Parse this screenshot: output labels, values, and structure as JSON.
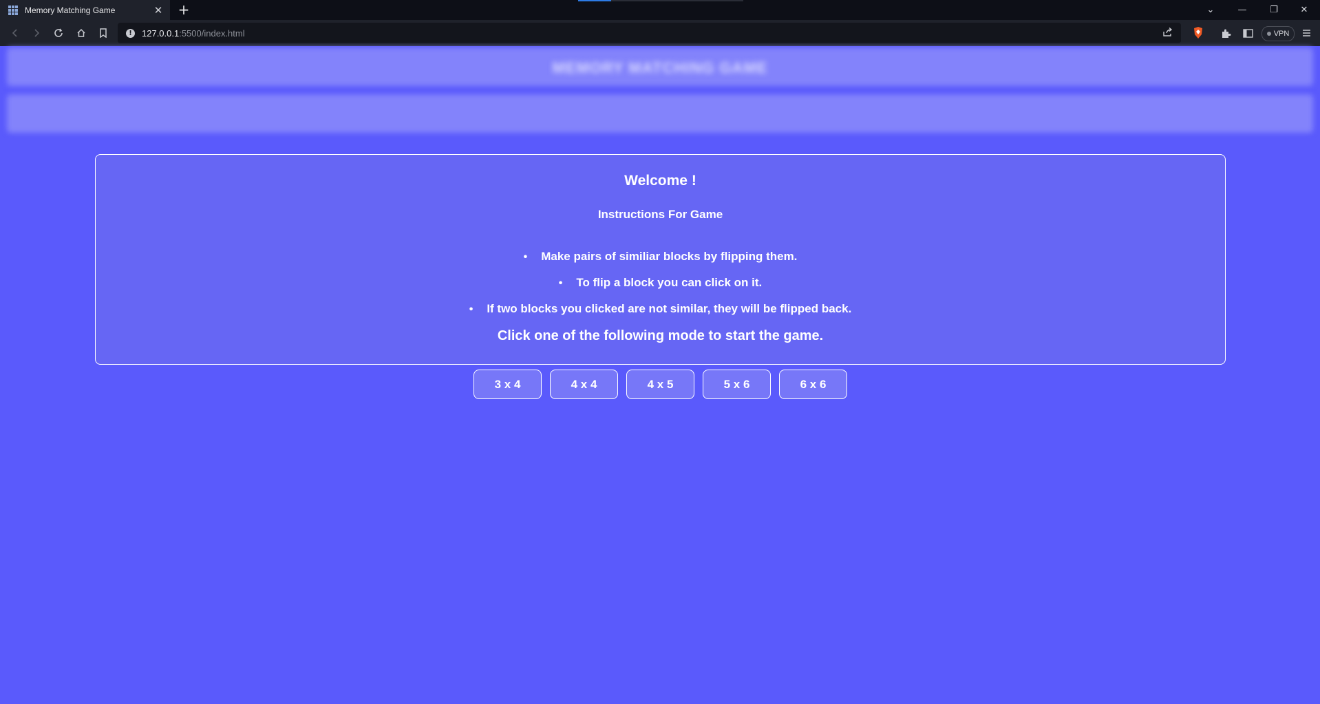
{
  "browser": {
    "tab_title": "Memory Matching Game",
    "tab_close": "✕",
    "new_tab": "+",
    "url_host": "127.0.0.1",
    "url_rest": ":5500/index.html",
    "vpn_label": "VPN",
    "window_controls": [
      "⌄",
      "—",
      "❐",
      "✕"
    ],
    "icons": [
      "back-icon",
      "forward-icon",
      "reload-icon",
      "home-icon",
      "bookmark-icon",
      "site-info-icon",
      "share-icon",
      "brave-shield-icon",
      "extensions-icon",
      "sidebar-icon",
      "menu-icon"
    ]
  },
  "page": {
    "blurred_title": "MEMORY MATCHING GAME",
    "welcome": "Welcome !",
    "instructions_heading": "Instructions For Game",
    "instructions": [
      "Make pairs of similiar blocks by flipping them.",
      "To flip a block you can click on it.",
      "If two blocks you clicked are not similar, they will be flipped back."
    ],
    "cta": "Click one of the following mode to start the game.",
    "modes": [
      "3 x 4",
      "4 x 4",
      "4 x 5",
      "5 x 6",
      "6 x 6"
    ]
  },
  "colors": {
    "page_background": "#5a5afc",
    "card_background": "#6666f4",
    "button_background": "#7777f8",
    "browser_chrome": "#1f222b",
    "tabbar": "#0d0f17"
  }
}
